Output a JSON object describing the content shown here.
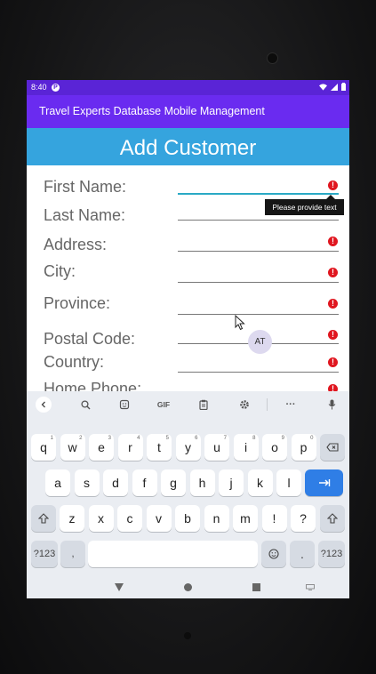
{
  "status": {
    "time": "8:40",
    "p_glyph": "P"
  },
  "appbar": {
    "title": "Travel Experts Database Mobile Management"
  },
  "page": {
    "title": "Add Customer"
  },
  "form": {
    "first_name": "First Name:",
    "last_name": "Last Name:",
    "address": "Address:",
    "city": "City:",
    "province": "Province:",
    "postal_code": "Postal Code:",
    "country": "Country:",
    "home_phone": "Home Phone:",
    "error_glyph": "!"
  },
  "tooltip": {
    "text": "Please provide text"
  },
  "bubble": {
    "text": "AT"
  },
  "keyboard": {
    "toolbar": {
      "gif": "GIF",
      "more": "···"
    },
    "row1": [
      {
        "k": "q",
        "n": "1"
      },
      {
        "k": "w",
        "n": "2"
      },
      {
        "k": "e",
        "n": "3"
      },
      {
        "k": "r",
        "n": "4"
      },
      {
        "k": "t",
        "n": "5"
      },
      {
        "k": "y",
        "n": "6"
      },
      {
        "k": "u",
        "n": "7"
      },
      {
        "k": "i",
        "n": "8"
      },
      {
        "k": "o",
        "n": "9"
      },
      {
        "k": "p",
        "n": "0"
      }
    ],
    "row2": [
      "a",
      "s",
      "d",
      "f",
      "g",
      "h",
      "j",
      "k",
      "l"
    ],
    "row3": [
      "z",
      "x",
      "c",
      "v",
      "b",
      "n",
      "m",
      "!",
      "?"
    ],
    "symbols": "?123",
    "comma": ",",
    "period": "."
  },
  "colors": {
    "statusbar": "#5a24d6",
    "appbar": "#6a2bf0",
    "header": "#35a4de",
    "error": "#e0161f",
    "enter_key": "#2f7ee6"
  }
}
